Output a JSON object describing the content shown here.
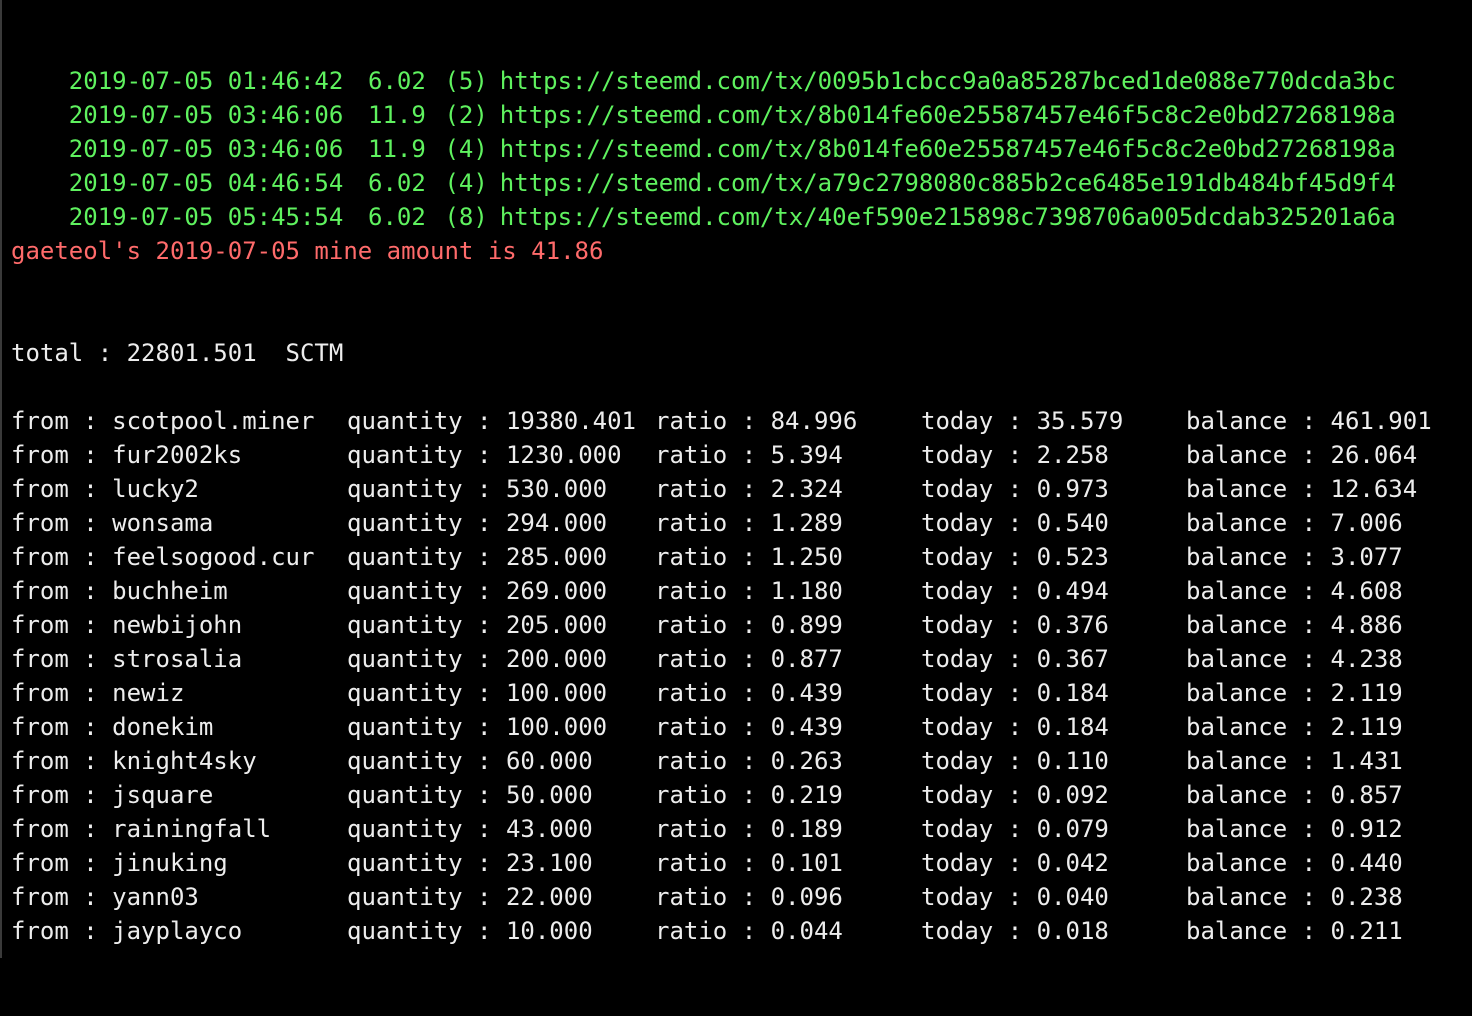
{
  "colors": {
    "background": "#000000",
    "transactions": "#5ff25f",
    "summary": "#ff6b6b",
    "table_text": "#ededed"
  },
  "transactions": [
    {
      "time": "2019-07-05 01:46:42",
      "amount": "6.02",
      "count": "(5)",
      "url": "https://steemd.com/tx/0095b1cbcc9a0a85287bced1de088e770dcda3bc"
    },
    {
      "time": "2019-07-05 03:46:06",
      "amount": "11.9",
      "count": "(2)",
      "url": "https://steemd.com/tx/8b014fe60e25587457e46f5c8c2e0bd27268198a"
    },
    {
      "time": "2019-07-05 03:46:06",
      "amount": "11.9",
      "count": "(4)",
      "url": "https://steemd.com/tx/8b014fe60e25587457e46f5c8c2e0bd27268198a"
    },
    {
      "time": "2019-07-05 04:46:54",
      "amount": "6.02",
      "count": "(4)",
      "url": "https://steemd.com/tx/a79c2798080c885b2ce6485e191db484bf45d9f4"
    },
    {
      "time": "2019-07-05 05:45:54",
      "amount": "6.02",
      "count": "(8)",
      "url": "https://steemd.com/tx/40ef590e215898c7398706a005dcdab325201a6a"
    }
  ],
  "summary": "gaeteol's 2019-07-05 mine amount is 41.86",
  "total": "total : 22801.501  SCTM",
  "rows": [
    {
      "from": "from : scotpool.miner",
      "quantity": "quantity : 19380.401",
      "ratio": "ratio : 84.996",
      "today": "today : 35.579",
      "balance": "balance : 461.901"
    },
    {
      "from": "from : fur2002ks",
      "quantity": "quantity : 1230.000",
      "ratio": "ratio : 5.394",
      "today": "today : 2.258",
      "balance": "balance : 26.064"
    },
    {
      "from": "from : lucky2",
      "quantity": "quantity : 530.000",
      "ratio": "ratio : 2.324",
      "today": "today : 0.973",
      "balance": "balance : 12.634"
    },
    {
      "from": "from : wonsama",
      "quantity": "quantity : 294.000",
      "ratio": "ratio : 1.289",
      "today": "today : 0.540",
      "balance": "balance : 7.006"
    },
    {
      "from": "from : feelsogood.cur",
      "quantity": "quantity : 285.000",
      "ratio": "ratio : 1.250",
      "today": "today : 0.523",
      "balance": "balance : 3.077"
    },
    {
      "from": "from : buchheim",
      "quantity": "quantity : 269.000",
      "ratio": "ratio : 1.180",
      "today": "today : 0.494",
      "balance": "balance : 4.608"
    },
    {
      "from": "from : newbijohn",
      "quantity": "quantity : 205.000",
      "ratio": "ratio : 0.899",
      "today": "today : 0.376",
      "balance": "balance : 4.886"
    },
    {
      "from": "from : strosalia",
      "quantity": "quantity : 200.000",
      "ratio": "ratio : 0.877",
      "today": "today : 0.367",
      "balance": "balance : 4.238"
    },
    {
      "from": "from : newiz",
      "quantity": "quantity : 100.000",
      "ratio": "ratio : 0.439",
      "today": "today : 0.184",
      "balance": "balance : 2.119"
    },
    {
      "from": "from : donekim",
      "quantity": "quantity : 100.000",
      "ratio": "ratio : 0.439",
      "today": "today : 0.184",
      "balance": "balance : 2.119"
    },
    {
      "from": "from : knight4sky",
      "quantity": "quantity : 60.000",
      "ratio": "ratio : 0.263",
      "today": "today : 0.110",
      "balance": "balance : 1.431"
    },
    {
      "from": "from : jsquare",
      "quantity": "quantity : 50.000",
      "ratio": "ratio : 0.219",
      "today": "today : 0.092",
      "balance": "balance : 0.857"
    },
    {
      "from": "from : rainingfall",
      "quantity": "quantity : 43.000",
      "ratio": "ratio : 0.189",
      "today": "today : 0.079",
      "balance": "balance : 0.912"
    },
    {
      "from": "from : jinuking",
      "quantity": "quantity : 23.100",
      "ratio": "ratio : 0.101",
      "today": "today : 0.042",
      "balance": "balance : 0.440"
    },
    {
      "from": "from : yann03",
      "quantity": "quantity : 22.000",
      "ratio": "ratio : 0.096",
      "today": "today : 0.040",
      "balance": "balance : 0.238"
    },
    {
      "from": "from : jayplayco",
      "quantity": "quantity : 10.000",
      "ratio": "ratio : 0.044",
      "today": "today : 0.018",
      "balance": "balance : 0.211"
    }
  ]
}
